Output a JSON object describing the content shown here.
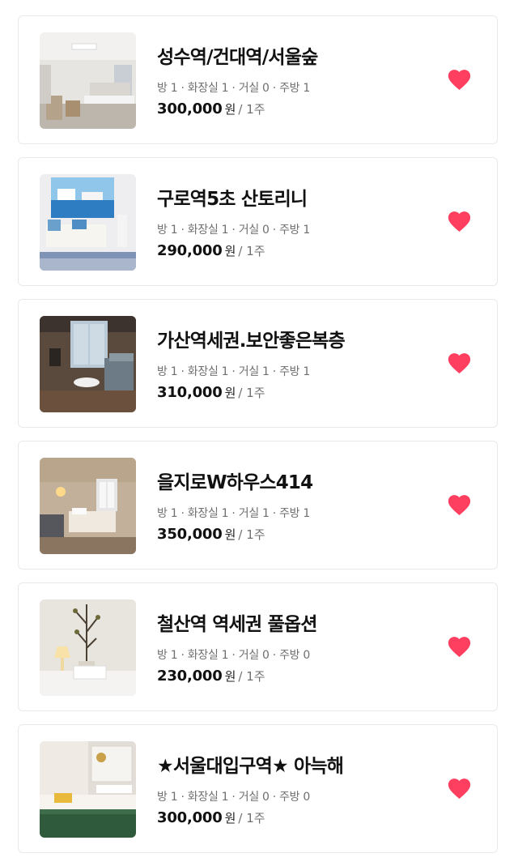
{
  "accent_color": "#ff3f5f",
  "listings": [
    {
      "title": "성수역/건대역/서울숲",
      "specs": "방 1 · 화장실 1 · 거실 0 · 주방 1",
      "price": "300,000",
      "currency": "원",
      "period": "/ 1주",
      "favorite_icon": "heart-filled-icon",
      "favorited": true
    },
    {
      "title": "구로역5초 산토리니",
      "specs": "방 1 · 화장실 1 · 거실 0 · 주방 1",
      "price": "290,000",
      "currency": "원",
      "period": "/ 1주",
      "favorite_icon": "heart-filled-icon",
      "favorited": true
    },
    {
      "title": "가산역세권.보안좋은복층",
      "specs": "방 1 · 화장실 1 · 거실 1 · 주방 1",
      "price": "310,000",
      "currency": "원",
      "period": "/ 1주",
      "favorite_icon": "heart-filled-icon",
      "favorited": true
    },
    {
      "title": "을지로W하우스414",
      "specs": "방 1 · 화장실 1 · 거실 1 · 주방 1",
      "price": "350,000",
      "currency": "원",
      "period": "/ 1주",
      "favorite_icon": "heart-filled-icon",
      "favorited": true
    },
    {
      "title": "철산역 역세권 풀옵션",
      "specs": "방 1 · 화장실 1 · 거실 0 · 주방 0",
      "price": "230,000",
      "currency": "원",
      "period": "/ 1주",
      "favorite_icon": "heart-filled-icon",
      "favorited": true
    },
    {
      "title": "★서울대입구역★ 아늑해",
      "specs": "방 1 · 화장실 1 · 거실 0 · 주방 0",
      "price": "300,000",
      "currency": "원",
      "period": "/ 1주",
      "favorite_icon": "heart-filled-icon",
      "favorited": true
    }
  ]
}
